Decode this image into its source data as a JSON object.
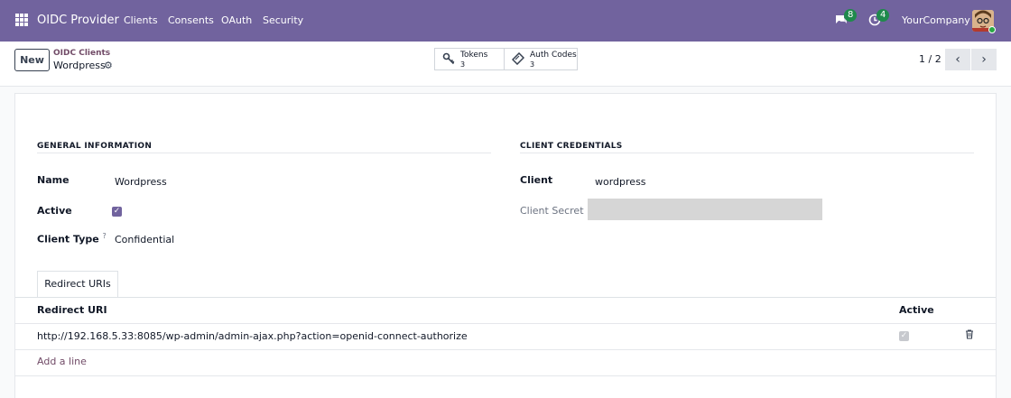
{
  "navbar": {
    "app_title": "OIDC Provider",
    "menu": [
      "Clients",
      "Consents",
      "OAuth",
      "Security"
    ],
    "messages_count": "8",
    "activities_count": "4",
    "company": "YourCompany",
    "color": "#71639e"
  },
  "control": {
    "new_label": "New",
    "breadcrumb_parent": "OIDC Clients",
    "breadcrumb_current": "Wordpress",
    "stat_buttons": [
      {
        "label": "Tokens",
        "value": "3",
        "icon": "key-icon"
      },
      {
        "label": "Auth Codes",
        "value": "3",
        "icon": "ticket-icon"
      }
    ],
    "pager": "1 / 2"
  },
  "form": {
    "general_title": "GENERAL INFORMATION",
    "credentials_title": "CLIENT CREDENTIALS",
    "name_label": "Name",
    "name_value": "Wordpress",
    "active_label": "Active",
    "active_value": true,
    "client_type_label": "Client Type",
    "client_type_help": "?",
    "client_type_value": "Confidential",
    "client_label": "Client",
    "client_value": "wordpress",
    "client_secret_label": "Client Secret"
  },
  "redirect_tab": {
    "tab_label": "Redirect URIs",
    "columns": [
      "Redirect URI",
      "Active"
    ],
    "rows": [
      {
        "uri": "http://192.168.5.33:8085/wp-admin/admin-ajax.php?action=openid-connect-authorize",
        "active": true
      }
    ],
    "add_line": "Add a line"
  }
}
